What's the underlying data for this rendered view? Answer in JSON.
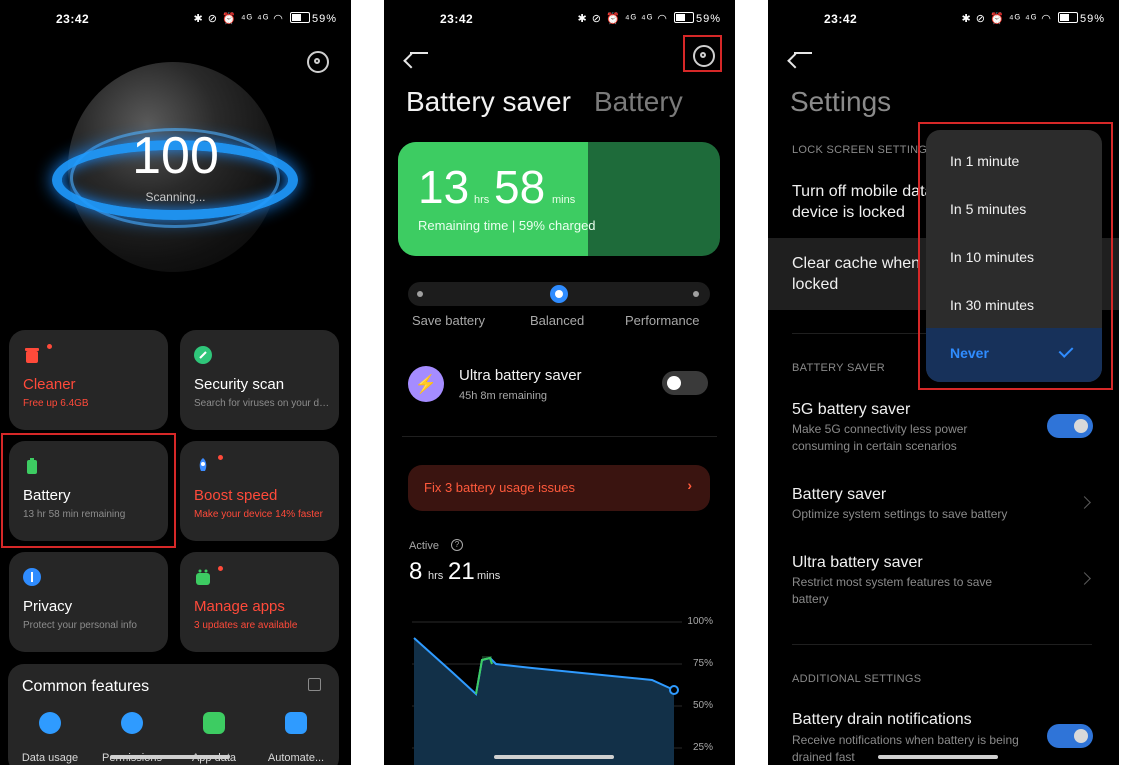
{
  "status_bar": {
    "time": "23:42",
    "icons": "✱ ⊘ ⏰ ⁴ᴳ ⁴ᴳ ◠",
    "battery": "59%"
  },
  "screen1": {
    "score": "100",
    "scanning": "Scanning...",
    "cards": [
      {
        "title": "Cleaner",
        "subtitle": "Free up 6.4GB",
        "color": "#ff4a3a",
        "icon": "trash-icon"
      },
      {
        "title": "Security scan",
        "subtitle": "Search for viruses on your device",
        "icon": "shield-icon"
      },
      {
        "title": "Battery",
        "subtitle": "13 hr 58 min  remaining",
        "icon": "battery-icon"
      },
      {
        "title": "Boost speed",
        "subtitle": "Make your device 14% faster",
        "color": "#ff4a3a",
        "icon": "rocket-icon"
      },
      {
        "title": "Privacy",
        "subtitle": "Protect your personal info",
        "icon": "privacy-icon"
      },
      {
        "title": "Manage apps",
        "subtitle": "3 updates are available",
        "color": "#ff4a3a",
        "icon": "apps-icon"
      }
    ],
    "common": {
      "title": "Common features",
      "items": [
        "Data usage",
        "Permissions",
        "App data",
        "Automate..."
      ]
    }
  },
  "screen2": {
    "title_active": "Battery saver",
    "title_inactive": "Battery",
    "remaining_hours": "13",
    "hours_unit": "hrs",
    "remaining_mins": "58",
    "mins_unit": "mins",
    "remaining_label": "Remaining time | 59% charged",
    "charge_fraction": 0.59,
    "modes": [
      "Save battery",
      "Balanced",
      "Performance"
    ],
    "selected_mode": "Balanced",
    "ultra_title": "Ultra battery saver",
    "ultra_sub": "45h 8m remaining",
    "fix_label": "Fix 3 battery usage issues",
    "active_label": "Active",
    "active_hours": "8",
    "active_mins": "21",
    "chart_axis": [
      "100%",
      "75%",
      "50%",
      "25%"
    ]
  },
  "screen3": {
    "title": "Settings",
    "lock_section": "LOCK SCREEN SETTINGS",
    "turn_off_line1": "Turn off mobile data when",
    "turn_off_line2": "device is locked",
    "clear_cache_line1": "Clear cache when",
    "clear_cache_line2": "locked",
    "dropdown": {
      "options": [
        "In 1 minute",
        "In 5 minutes",
        "In 10 minutes",
        "In 30 minutes",
        "Never"
      ],
      "selected": "Never"
    },
    "battery_section": "BATTERY SAVER",
    "fiveg_title": "5G battery saver",
    "fiveg_sub": "Make 5G connectivity less power consuming in certain scenarios",
    "saver_title": "Battery saver",
    "saver_sub": "Optimize system settings to save battery",
    "ultra_title": "Ultra battery saver",
    "ultra_sub": "Restrict most system features to save battery",
    "additional_section": "ADDITIONAL SETTINGS",
    "drain_title": "Battery drain notifications",
    "drain_sub": "Receive notifications when battery is being drained fast"
  }
}
